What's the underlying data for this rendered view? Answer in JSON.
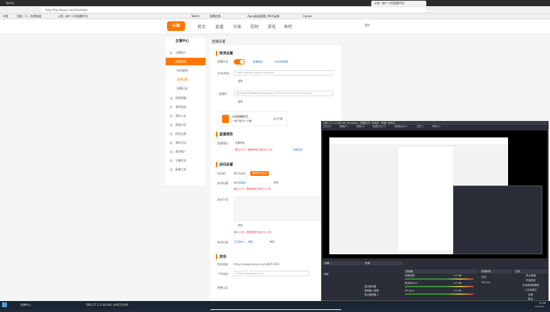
{
  "browser": {
    "tabs": [
      "Twitch",
      "斗鱼 - 每个人的直播平台"
    ],
    "address": "http://mp.douyu.com/live/main",
    "bookmarks": [
      "书签",
      "百度一下，你就知道",
      "斗鱼—每个人的直播平台",
      "Twitch",
      "直播信息",
      "Apex英雄直播_APEX英雄",
      "Coplee"
    ]
  },
  "site": {
    "logo": "斗鱼",
    "nav": [
      "首页",
      "直播",
      "分类",
      "视频",
      "游戏",
      "鱼吧"
    ],
    "user": "我的"
  },
  "sidebar": {
    "title": "主播中心",
    "items": [
      "主播简介",
      "直播相关",
      "房间管理",
      "直播设置",
      "直播记录",
      "视频直播",
      "我的收益",
      "我的公会",
      "数据分析",
      "粉丝运营",
      "我的活动",
      "我的推广",
      "主播任务",
      "直播工具"
    ]
  },
  "main": {
    "crumb": "直播设置",
    "stream_title": "推流设置",
    "toggle_label": "直播开关",
    "link1": "直播教程",
    "link2": "OBS使用教程",
    "rtmp_label": "rtmp地址",
    "rtmp_value": "rtmp://sendtc3.douyu.com/live",
    "copy": "复制",
    "code_label": "直播码",
    "code_value": "8971463r5Q8BbUN?wsSecret=**************************&wsT",
    "promo_title": "斗鱼直播伴侣",
    "promo_sub": "一键开播 新人必备",
    "promo_btn": "点击下载",
    "notice_title": "直播预告",
    "notice_label": "直播预告",
    "notice_btn": "设置预告",
    "notice_hint": "最长20字，需要审核不超过24小时",
    "notice_link": "查看说明",
    "room_title": "房间设置",
    "room_id_label": "房间ID",
    "room_id": "8971463",
    "room_badge": "房间号已认证",
    "room_name_label": "房间标题",
    "room_name": "我的直播间",
    "edit": "修改",
    "room_desc_label": "房间介绍",
    "room_cat_label": "房间分类",
    "room_cat": "主机游戏——最新",
    "other_title": "其他",
    "other_label": "房间链接",
    "other_link": "https://www.douyu.com/8971463",
    "domain_label": "个性域名",
    "domain_value": "http://www.douyu.com/",
    "auth_label": "直播认证"
  },
  "obs": {
    "title": "OBS 27.1.3 (64-bit, windows) - 配置文件: 未命名 - 场景: 未命名",
    "menus": [
      "文件(F)",
      "编辑(E)",
      "视图(V)",
      "配置文件(P)",
      "场景集合(S)",
      "工具(T)",
      "帮助(H)"
    ],
    "panels": [
      "场景",
      "来源",
      "混音器",
      "转场特效",
      "控件"
    ],
    "scene": "场景",
    "sources": [
      "显示器采集",
      "音频输入捕获",
      "显示器采集 2"
    ],
    "mixer": [
      "桌面音频",
      "麦克风/Aux",
      "Mic/Aux"
    ],
    "mixer_db": [
      "0.0 dB",
      "0.0 dB",
      "0.0 dB"
    ],
    "transition": "淡出",
    "duration": "300 ms",
    "controls": [
      "停止直播",
      "开始录制",
      "启动虚拟摄像机",
      "工作室模式",
      "设置",
      "退出"
    ],
    "status": "LIVE: 00:10:14  REC: 00:00:00  CPU: 3.8%, 60.00 fps"
  },
  "taskbar": {
    "items": [
      "主播中心",
      "OBS 27.1.3 (64-bit, win",
      "打开文件"
    ],
    "time": "14:06",
    "date": "2022/4/3"
  }
}
